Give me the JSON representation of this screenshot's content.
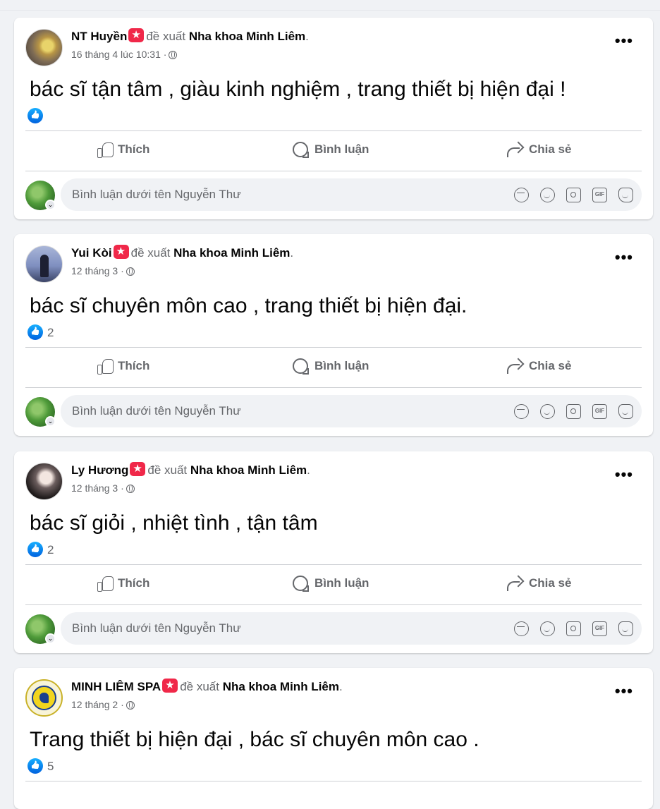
{
  "posts": [
    {
      "author": "NT Huyền",
      "recommends": "đề xuất",
      "page": "Nha khoa Minh Liêm",
      "period": ".",
      "time": "16 tháng 4 lúc 10:31",
      "separator": "·",
      "text": "bác sĩ tận tâm , giàu kinh nghiệm , trang thiết bị hiện đại !",
      "like_count": ""
    },
    {
      "author": "Yui Kòi",
      "recommends": "đề xuất",
      "page": "Nha khoa Minh Liêm",
      "period": ".",
      "time": "12 tháng 3",
      "separator": "·",
      "text": "bác sĩ chuyên môn cao , trang thiết bị hiện đại.",
      "like_count": "2"
    },
    {
      "author": "Ly Hương",
      "recommends": "đề xuất",
      "page": "Nha khoa Minh Liêm",
      "period": ".",
      "time": "12 tháng 3",
      "separator": "·",
      "text": "bác sĩ giỏi , nhiệt tình , tận tâm",
      "like_count": "2"
    },
    {
      "author": "MINH LIÊM SPA",
      "recommends": "đề xuất",
      "page": "Nha khoa Minh Liêm",
      "period": ".",
      "time": "12 tháng 2",
      "separator": "·",
      "text": "Trang thiết bị hiện đại , bác sĩ chuyên môn cao .",
      "like_count": "5"
    }
  ],
  "actions": {
    "like": "Thích",
    "comment": "Bình luận",
    "share": "Chia sẻ"
  },
  "composer": {
    "placeholder": "Bình luận dưới tên Nguyễn Thư",
    "gif_label": "GIF"
  },
  "more_label": "•••",
  "colors": {
    "background": "#f0f2f5",
    "card": "#ffffff",
    "secondary_text": "#65676b",
    "recommend_badge": "#f02849",
    "like_blue": "#0866ff"
  }
}
